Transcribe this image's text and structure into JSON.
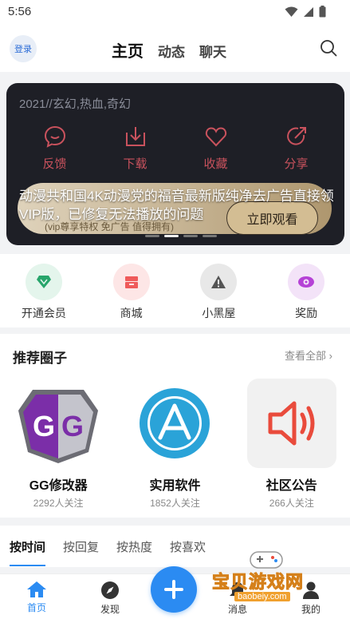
{
  "status_bar": {
    "time": "5:56"
  },
  "header": {
    "login_label": "登录",
    "tabs": [
      {
        "label": "主页",
        "active": true
      },
      {
        "label": "动态",
        "active": false
      },
      {
        "label": "聊天",
        "active": false
      }
    ]
  },
  "banner": {
    "tags": "2021//玄幻,热血,奇幻",
    "actions": [
      {
        "label": "反馈",
        "icon": "message-icon"
      },
      {
        "label": "下载",
        "icon": "download-icon"
      },
      {
        "label": "收藏",
        "icon": "heart-icon"
      },
      {
        "label": "分享",
        "icon": "share-icon"
      }
    ],
    "overlay_text": "动漫共和国4K动漫党的福音最新版纯净去广告直接领VIP版，已修复无法播放的问题",
    "vip_subtext": "(vip尊享特权 免广告 值得拥有)",
    "watch_button": "立即观看",
    "page_dots": 4,
    "active_dot": 1
  },
  "quick_links": [
    {
      "label": "开通会员",
      "icon": "diamond-icon",
      "color": "#27a56b",
      "bg": "#e4f5ec"
    },
    {
      "label": "商城",
      "icon": "store-icon",
      "color": "#ef5a5a",
      "bg": "#fde6e6"
    },
    {
      "label": "小黑屋",
      "icon": "warning-icon",
      "color": "#555555",
      "bg": "#e8e8e8"
    },
    {
      "label": "奖励",
      "icon": "reward-icon",
      "color": "#b541d6",
      "bg": "#f3e3f8"
    }
  ],
  "circles": {
    "title": "推荐圈子",
    "more_label": "查看全部",
    "items": [
      {
        "name": "GG修改器",
        "followers": "2292人关注",
        "icon": "gg-logo-icon"
      },
      {
        "name": "实用软件",
        "followers": "1852人关注",
        "icon": "app-store-icon"
      },
      {
        "name": "社区公告",
        "followers": "266人关注",
        "icon": "speaker-icon"
      }
    ]
  },
  "sort_tabs": [
    {
      "label": "按时间",
      "active": true
    },
    {
      "label": "按回复",
      "active": false
    },
    {
      "label": "按热度",
      "active": false
    },
    {
      "label": "按喜欢",
      "active": false
    }
  ],
  "bottom_nav": [
    {
      "label": "首页",
      "icon": "home-icon",
      "active": true
    },
    {
      "label": "发现",
      "icon": "compass-icon",
      "active": false
    },
    {
      "label": "消息",
      "icon": "bell-icon",
      "active": false
    },
    {
      "label": "我的",
      "icon": "user-icon",
      "active": false
    }
  ],
  "watermark": {
    "text": "宝贝游戏网",
    "url": "baobeiy.com"
  },
  "colors": {
    "accent": "#2b8bf2",
    "banner_icon": "#c9525d"
  }
}
